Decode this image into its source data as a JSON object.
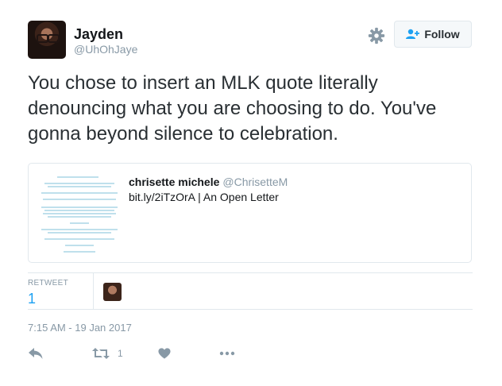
{
  "author": {
    "name": "Jayden",
    "handle": "@UhOhJaye"
  },
  "follow_label": "Follow",
  "tweet_text": "You chose to insert an MLK quote literally denouncing what you are choosing to do. You've gonna beyond silence to celebration.",
  "card": {
    "title": "chrisette michele",
    "handle": "@ChrisetteM",
    "description": "bit.ly/2iTzOrA | An Open Letter"
  },
  "stats": {
    "retweet_label": "RETWEET",
    "retweet_count": "1"
  },
  "timestamp": "7:15 AM - 19 Jan 2017",
  "actions": {
    "retweet_count": "1"
  },
  "colors": {
    "link_blue": "#1da1f2",
    "muted": "#8899a6",
    "border": "#e1e8ed"
  },
  "icons": [
    "gear-icon",
    "follow-person-icon",
    "reply-icon",
    "retweet-icon",
    "like-heart-icon",
    "more-icon"
  ]
}
